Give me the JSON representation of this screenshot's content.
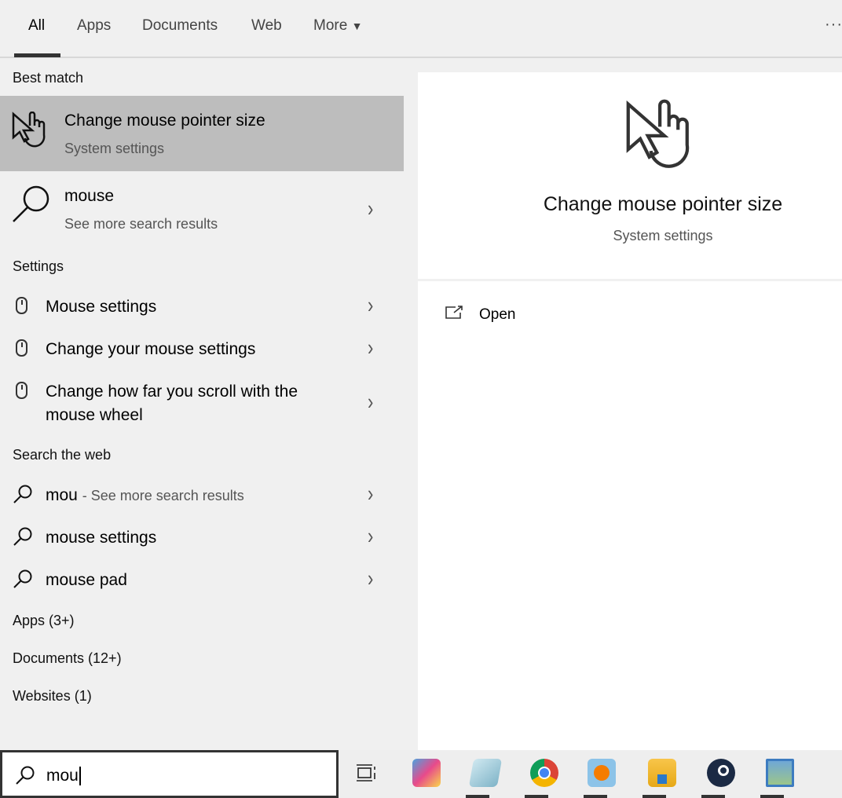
{
  "tabs": [
    {
      "label": "All"
    },
    {
      "label": "Apps"
    },
    {
      "label": "Documents"
    },
    {
      "label": "Web"
    },
    {
      "label": "More"
    }
  ],
  "best_match": {
    "header": "Best match",
    "title": "Change mouse pointer size",
    "subtitle": "System settings"
  },
  "search_more": {
    "title": "mouse",
    "subtitle": "See more search results"
  },
  "settings": {
    "header": "Settings",
    "items": [
      {
        "label": "Mouse settings"
      },
      {
        "label": "Change your mouse settings"
      },
      {
        "label": "Change how far you scroll with the",
        "label2": "mouse wheel"
      }
    ]
  },
  "web": {
    "header": "Search the web",
    "items": [
      {
        "label": "mou",
        "suffix": "- See more search results"
      },
      {
        "label": "mouse settings"
      },
      {
        "label": "mouse pad"
      }
    ]
  },
  "categories": [
    {
      "label": "Apps (3+)"
    },
    {
      "label": "Documents (12+)"
    },
    {
      "label": "Websites (1)"
    }
  ],
  "preview": {
    "title": "Change mouse pointer size",
    "subtitle": "System settings",
    "open_label": "Open"
  },
  "search": {
    "value": "mou"
  },
  "colors": {
    "selected": "#bdbdbd",
    "panel": "#f0f0f0"
  }
}
